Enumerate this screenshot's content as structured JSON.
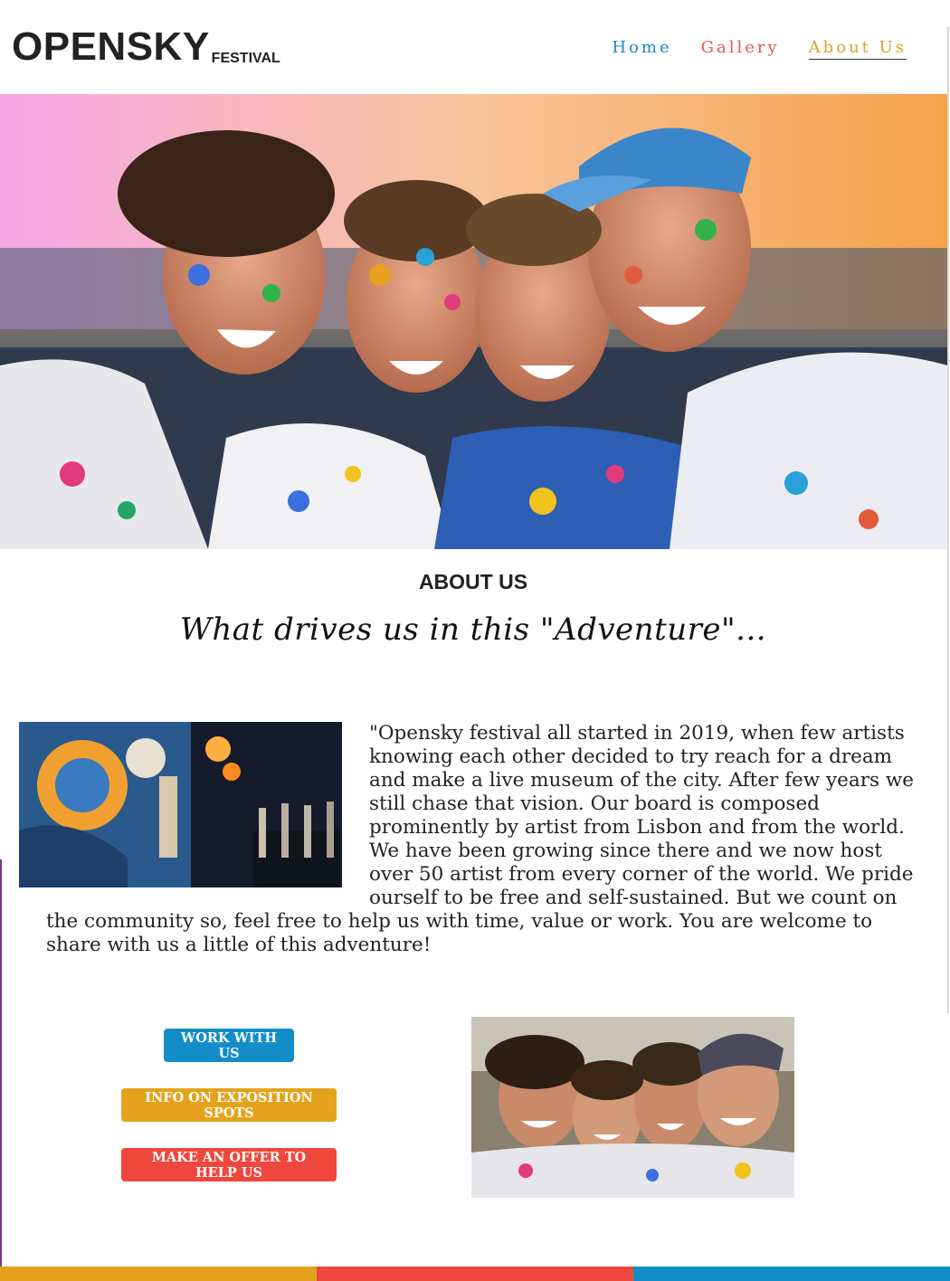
{
  "header": {
    "logo_main": "OPENSKY",
    "logo_sub": "FESTIVAL",
    "nav": [
      {
        "label": "Home",
        "color": "#1b8bc0"
      },
      {
        "label": "Gallery",
        "color": "#e8574a"
      },
      {
        "label": "About Us",
        "color": "#dba32a",
        "active": true
      }
    ]
  },
  "about": {
    "title": "ABOUT US",
    "tagline": "What drives us in this \"Adventure\"...",
    "story": "\"Opensky festival all started in 2019, when few artists knowing each other decided to try reach for a dream and make a live museum of the city. After few years we still chase that vision. Our board is composed prominently by artist from Lisbon and from the world. We have been growing since there and we now host over 50 artist from every corner of the world. We pride ourself to be free and self-sustained. But we count on the community so, feel free to help us with time, value or work. You are welcome to share with us a little of this adventure!"
  },
  "buttons": {
    "work": "WORK WITH US",
    "info": "INFO ON EXPOSITION SPOTS",
    "offer": "MAKE AN OFFER TO HELP US"
  },
  "colors": {
    "blue": "#138dc7",
    "yellow": "#e5a31d",
    "red": "#f0473d",
    "footer": [
      "#e5a31d",
      "#f0473d",
      "#138dc7"
    ]
  }
}
